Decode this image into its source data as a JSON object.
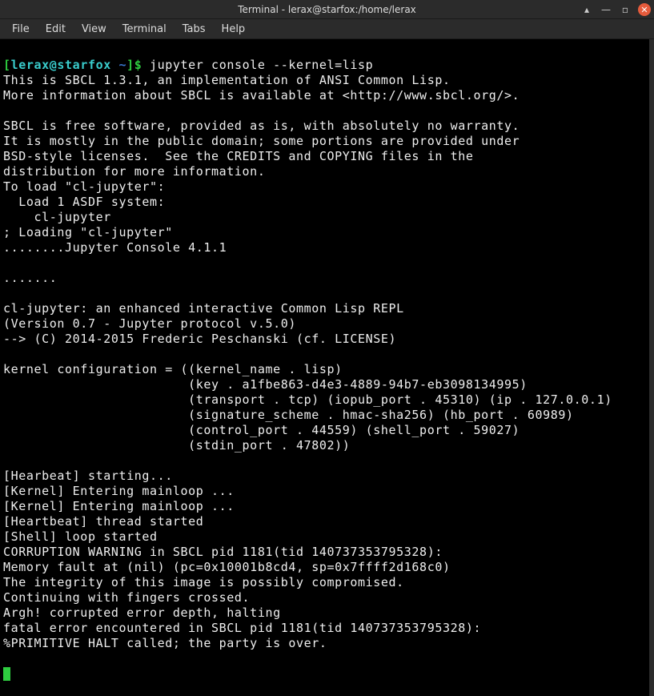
{
  "titlebar": {
    "title": "Terminal - lerax@starfox:/home/lerax"
  },
  "menubar": {
    "file": "File",
    "edit": "Edit",
    "view": "View",
    "terminal": "Terminal",
    "tabs": "Tabs",
    "help": "Help"
  },
  "prompt": {
    "open": "[",
    "userhost": "lerax@starfox",
    "path": " ~",
    "close": "]$ ",
    "command": "jupyter console --kernel=lisp"
  },
  "output": {
    "l01": "This is SBCL 1.3.1, an implementation of ANSI Common Lisp.",
    "l02": "More information about SBCL is available at <http://www.sbcl.org/>.",
    "l03": "",
    "l04": "SBCL is free software, provided as is, with absolutely no warranty.",
    "l05": "It is mostly in the public domain; some portions are provided under",
    "l06": "BSD-style licenses.  See the CREDITS and COPYING files in the",
    "l07": "distribution for more information.",
    "l08": "To load \"cl-jupyter\":",
    "l09": "  Load 1 ASDF system:",
    "l10": "    cl-jupyter",
    "l11": "; Loading \"cl-jupyter\"",
    "l12": "........Jupyter Console 4.1.1",
    "l13": "",
    "l14": ".......",
    "l15": "",
    "l16": "cl-jupyter: an enhanced interactive Common Lisp REPL",
    "l17": "(Version 0.7 - Jupyter protocol v.5.0)",
    "l18": "--> (C) 2014-2015 Frederic Peschanski (cf. LICENSE)",
    "l19": "",
    "l20": "kernel configuration = ((kernel_name . lisp)",
    "l21": "                        (key . a1fbe863-d4e3-4889-94b7-eb3098134995)",
    "l22": "                        (transport . tcp) (iopub_port . 45310) (ip . 127.0.0.1)",
    "l23": "                        (signature_scheme . hmac-sha256) (hb_port . 60989)",
    "l24": "                        (control_port . 44559) (shell_port . 59027)",
    "l25": "                        (stdin_port . 47802))",
    "l26": "",
    "l27": "[Hearbeat] starting...",
    "l28": "[Kernel] Entering mainloop ...",
    "l29": "[Kernel] Entering mainloop ...",
    "l30": "[Heartbeat] thread started",
    "l31": "[Shell] loop started",
    "l32": "CORRUPTION WARNING in SBCL pid 1181(tid 140737353795328):",
    "l33": "Memory fault at (nil) (pc=0x10001b8cd4, sp=0x7ffff2d168c0)",
    "l34": "The integrity of this image is possibly compromised.",
    "l35": "Continuing with fingers crossed.",
    "l36": "Argh! corrupted error depth, halting",
    "l37": "fatal error encountered in SBCL pid 1181(tid 140737353795328):",
    "l38": "%PRIMITIVE HALT called; the party is over.",
    "l39": ""
  }
}
